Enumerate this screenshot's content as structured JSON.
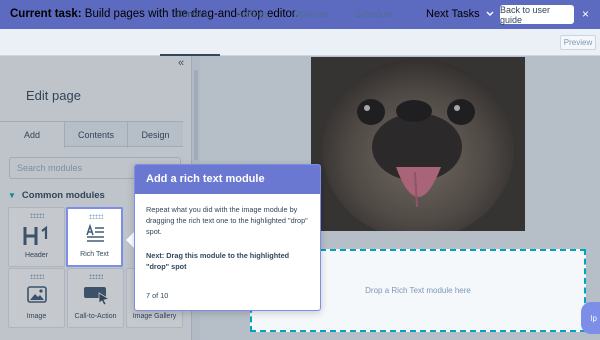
{
  "taskbar": {
    "label": "Current task:",
    "text": "Build pages with the drag-and-drop editor.",
    "next_tasks": "Next Tasks",
    "back_button": "Back to user guide",
    "close": "×",
    "bg_color": "#5c6bc0"
  },
  "tabs": [
    "Content",
    "Settings",
    "Optimize",
    "Schedule"
  ],
  "active_tab": "Content",
  "preview_label": "Preview",
  "sidebar": {
    "title": "Edit page",
    "tabs": [
      "Add",
      "Contents",
      "Design"
    ],
    "search_placeholder": "Search modules",
    "section": "Common modules",
    "modules": [
      "Header",
      "Rich Text",
      "Image",
      "Call-to-Action",
      "Image Gallery"
    ]
  },
  "canvas": {
    "drop_text": "Drop a Rich Text module here",
    "help_text": "lp",
    "accent": "#00a4bd"
  },
  "tooltip": {
    "title": "Add a rich text module",
    "body": "Repeat what you did with the image module by dragging the rich text one to the highlighted \"drop\" spot.",
    "next": "Next: Drag this module to the highlighted \"drop\" spot",
    "step": "7 of 10",
    "header_color": "#6a78d1"
  },
  "icons": {
    "collapse": "double-chevron-left-icon",
    "next_tasks": "chevron-down-icon",
    "section": "chevron-down-icon"
  }
}
